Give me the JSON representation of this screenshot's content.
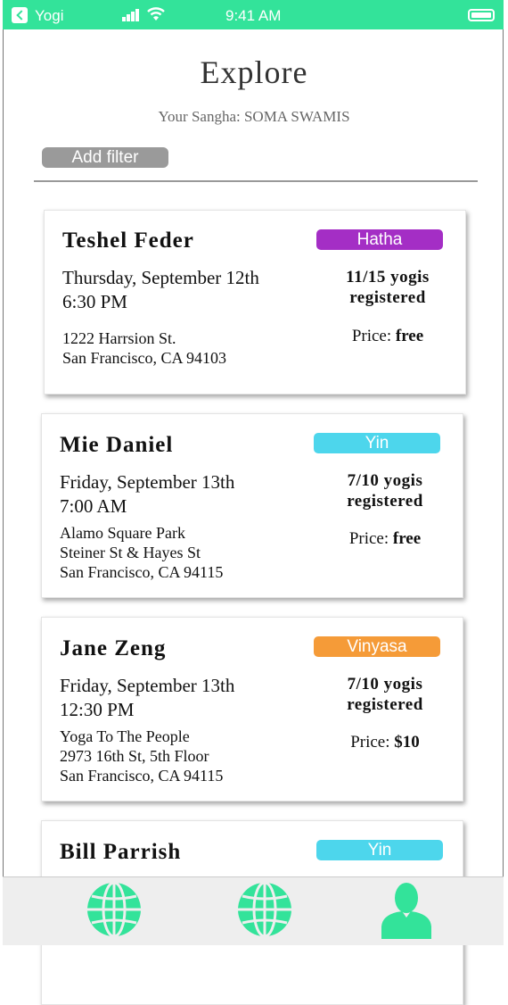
{
  "status_bar": {
    "carrier": "Yogi",
    "time": "9:41 AM"
  },
  "header": {
    "title": "Explore",
    "sangha": "Your Sangha: SOMA SWAMIS"
  },
  "filter": {
    "label": "Add filter"
  },
  "colors": {
    "accent": "#33e39a",
    "hatha": "#a42ec5",
    "yin": "#4dd6ec",
    "vinyasa": "#f59b38"
  },
  "events": [
    {
      "name": "Teshel Feder",
      "date": "Thursday, September 12th",
      "time": "6:30 PM",
      "address": [
        "1222 Harrsion St.",
        "San Francisco, CA 94103"
      ],
      "style": "Hatha",
      "registered": [
        "11/15 yogis",
        "registered"
      ],
      "price_label": "Price:",
      "price": "free"
    },
    {
      "name": "Mie Daniel",
      "date": "Friday, September 13th",
      "time": "7:00 AM",
      "address": [
        "Alamo Square Park",
        "Steiner St & Hayes St",
        "San Francisco, CA 94115"
      ],
      "style": "Yin",
      "registered": [
        "7/10 yogis",
        "registered"
      ],
      "price_label": "Price:",
      "price": "free"
    },
    {
      "name": "Jane Zeng",
      "date": "Friday, September 13th",
      "time": "12:30 PM",
      "address": [
        "Yoga To The People",
        "2973 16th St, 5th Floor",
        "San Francisco, CA 94115"
      ],
      "style": "Vinyasa",
      "registered": [
        "7/10 yogis",
        "registered"
      ],
      "price_label": "Price:",
      "price": "$10"
    },
    {
      "name": "Bill Parrish",
      "style": "Yin"
    }
  ],
  "tabs": [
    {
      "icon": "globe-icon"
    },
    {
      "icon": "globe-icon"
    },
    {
      "icon": "person-icon"
    }
  ]
}
